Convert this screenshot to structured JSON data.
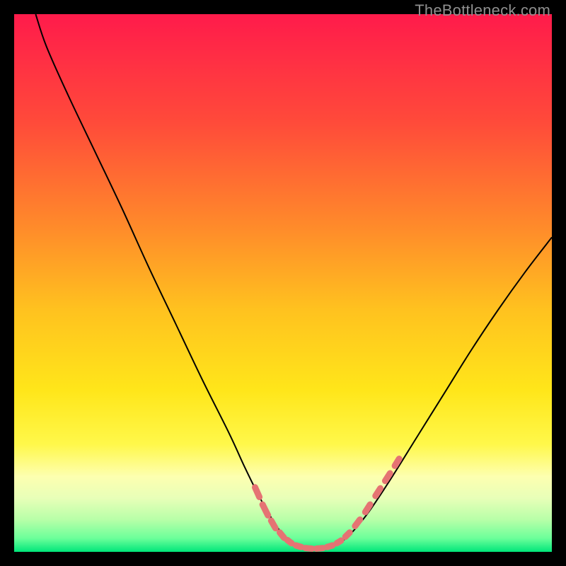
{
  "watermark": "TheBottleneck.com",
  "chart_data": {
    "type": "line",
    "title": "",
    "xlabel": "",
    "ylabel": "",
    "xlim": [
      0,
      100
    ],
    "ylim": [
      0,
      100
    ],
    "background_gradient": {
      "stops": [
        {
          "offset": 0.0,
          "color": "#ff1b4b"
        },
        {
          "offset": 0.2,
          "color": "#ff4a3a"
        },
        {
          "offset": 0.4,
          "color": "#ff8c2a"
        },
        {
          "offset": 0.55,
          "color": "#ffc21f"
        },
        {
          "offset": 0.7,
          "color": "#ffe61a"
        },
        {
          "offset": 0.8,
          "color": "#fff84a"
        },
        {
          "offset": 0.86,
          "color": "#fdffb0"
        },
        {
          "offset": 0.9,
          "color": "#e8ffb8"
        },
        {
          "offset": 0.94,
          "color": "#b8ffa8"
        },
        {
          "offset": 0.975,
          "color": "#6bff9a"
        },
        {
          "offset": 1.0,
          "color": "#00e67a"
        }
      ]
    },
    "series": [
      {
        "name": "bottleneck-curve",
        "color": "#000000",
        "points": [
          {
            "x": 4.0,
            "y": 100.0
          },
          {
            "x": 6.0,
            "y": 94.0
          },
          {
            "x": 10.0,
            "y": 85.0
          },
          {
            "x": 15.0,
            "y": 74.5
          },
          {
            "x": 20.0,
            "y": 64.0
          },
          {
            "x": 25.0,
            "y": 53.0
          },
          {
            "x": 30.0,
            "y": 42.5
          },
          {
            "x": 35.0,
            "y": 32.0
          },
          {
            "x": 40.0,
            "y": 22.0
          },
          {
            "x": 43.0,
            "y": 15.5
          },
          {
            "x": 46.0,
            "y": 9.5
          },
          {
            "x": 49.0,
            "y": 4.5
          },
          {
            "x": 51.0,
            "y": 2.3
          },
          {
            "x": 53.0,
            "y": 1.0
          },
          {
            "x": 55.0,
            "y": 0.5
          },
          {
            "x": 57.0,
            "y": 0.5
          },
          {
            "x": 59.0,
            "y": 1.0
          },
          {
            "x": 61.0,
            "y": 2.0
          },
          {
            "x": 63.0,
            "y": 3.8
          },
          {
            "x": 66.0,
            "y": 7.5
          },
          {
            "x": 70.0,
            "y": 13.5
          },
          {
            "x": 75.0,
            "y": 21.5
          },
          {
            "x": 80.0,
            "y": 29.5
          },
          {
            "x": 85.0,
            "y": 37.5
          },
          {
            "x": 90.0,
            "y": 45.0
          },
          {
            "x": 95.0,
            "y": 52.0
          },
          {
            "x": 100.0,
            "y": 58.5
          }
        ]
      }
    ],
    "markers": {
      "name": "highlight-dashes",
      "color": "#e57373",
      "segments": [
        {
          "x1": 44.8,
          "y1": 12.0,
          "x2": 45.6,
          "y2": 10.2
        },
        {
          "x1": 46.2,
          "y1": 8.8,
          "x2": 47.2,
          "y2": 6.8
        },
        {
          "x1": 47.8,
          "y1": 5.8,
          "x2": 48.6,
          "y2": 4.4
        },
        {
          "x1": 49.4,
          "y1": 3.6,
          "x2": 50.2,
          "y2": 2.6
        },
        {
          "x1": 50.8,
          "y1": 2.2,
          "x2": 51.6,
          "y2": 1.6
        },
        {
          "x1": 52.4,
          "y1": 1.2,
          "x2": 53.4,
          "y2": 0.9
        },
        {
          "x1": 54.2,
          "y1": 0.7,
          "x2": 55.4,
          "y2": 0.6
        },
        {
          "x1": 56.2,
          "y1": 0.6,
          "x2": 57.4,
          "y2": 0.7
        },
        {
          "x1": 58.2,
          "y1": 0.9,
          "x2": 59.2,
          "y2": 1.2
        },
        {
          "x1": 60.0,
          "y1": 1.6,
          "x2": 60.8,
          "y2": 2.1
        },
        {
          "x1": 61.6,
          "y1": 2.8,
          "x2": 62.4,
          "y2": 3.6
        },
        {
          "x1": 63.4,
          "y1": 4.8,
          "x2": 64.3,
          "y2": 6.0
        },
        {
          "x1": 65.3,
          "y1": 7.4,
          "x2": 66.2,
          "y2": 8.8
        },
        {
          "x1": 67.2,
          "y1": 10.4,
          "x2": 68.1,
          "y2": 11.8
        },
        {
          "x1": 69.0,
          "y1": 13.2,
          "x2": 69.9,
          "y2": 14.6
        },
        {
          "x1": 70.8,
          "y1": 16.0,
          "x2": 71.6,
          "y2": 17.3
        }
      ]
    }
  }
}
